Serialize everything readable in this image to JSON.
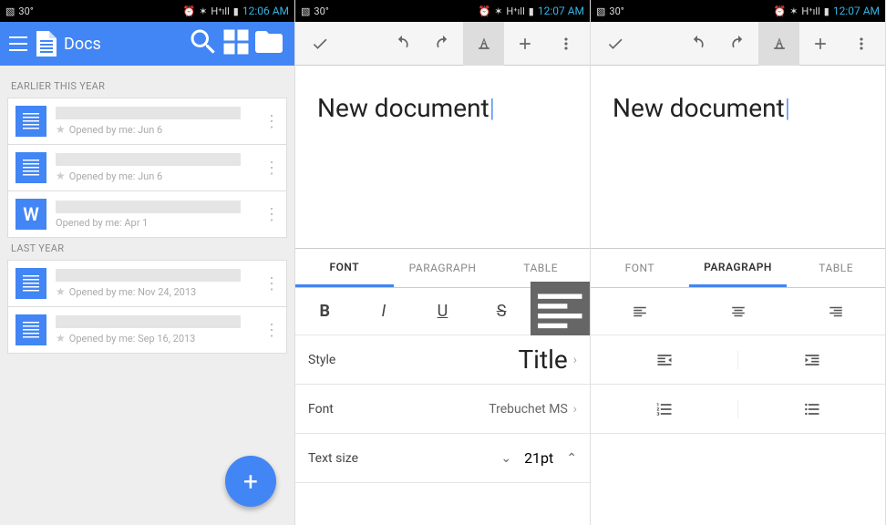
{
  "status": {
    "temp": "30°",
    "time_a": "12:06 AM",
    "time_b": "12:07 AM",
    "time_c": "12:07 AM"
  },
  "panelA": {
    "app_title": "Docs",
    "sections": [
      {
        "header": "EARLIER THIS YEAR",
        "items": [
          {
            "meta": "Opened by me: Jun 6",
            "type": "doc"
          },
          {
            "meta": "Opened by me: Jun 6",
            "type": "doc"
          },
          {
            "meta": "Opened by me: Apr 1",
            "type": "word",
            "glyph": "W"
          }
        ]
      },
      {
        "header": "LAST YEAR",
        "items": [
          {
            "meta": "Opened by me: Nov 24, 2013",
            "type": "doc"
          },
          {
            "meta": "Opened by me: Sep 16, 2013",
            "type": "doc"
          }
        ]
      }
    ],
    "fab": "+"
  },
  "editor": {
    "doc_text": "New document"
  },
  "tabs": {
    "font": "FONT",
    "paragraph": "PARAGRAPH",
    "table": "TABLE"
  },
  "fontPanel": {
    "style_label": "Style",
    "style_value": "Title",
    "font_label": "Font",
    "font_value": "Trebuchet MS",
    "size_label": "Text size",
    "size_value": "21pt"
  }
}
